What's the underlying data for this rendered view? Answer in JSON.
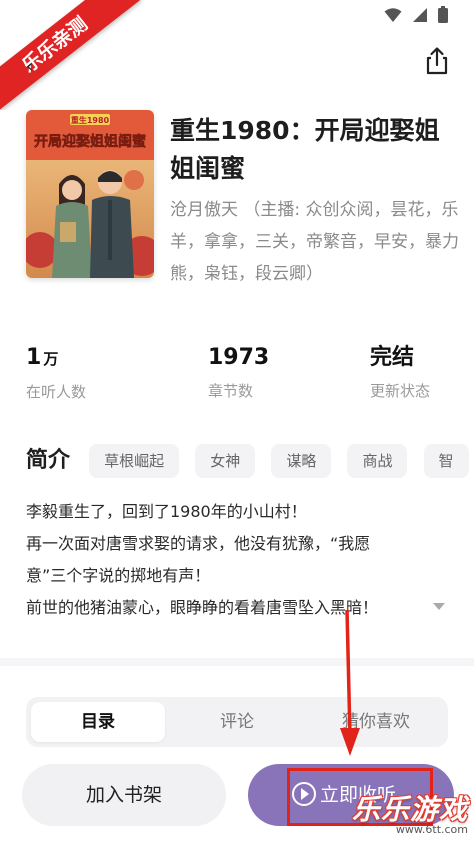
{
  "status_bar": {
    "icons": [
      "wifi-icon",
      "signal-icon",
      "battery-icon"
    ]
  },
  "watermark_ribbon": "乐乐亲测",
  "header": {
    "share_icon": "share-icon"
  },
  "book": {
    "title": "重生1980：开局迎娶姐姐闺蜜",
    "author_line": "沧月傲天 （主播: 众创众阅，昙花，乐羊，拿拿，三关，帝繁音，早安，暴力熊，枭钰，段云卿）",
    "cover": {
      "top_banner": "重生1980",
      "title": "开局迎娶姐姐闺蜜"
    }
  },
  "stats": [
    {
      "value": "1",
      "unit": "万",
      "label": "在听人数"
    },
    {
      "value": "1973",
      "unit": "",
      "label": "章节数"
    },
    {
      "value": "完结",
      "unit": "",
      "label": "更新状态"
    }
  ],
  "intro": {
    "heading": "简介",
    "tags": [
      "草根崛起",
      "女神",
      "谋略",
      "商战",
      "智"
    ],
    "lines": [
      "李毅重生了，回到了1980年的小山村！",
      "再一次面对唐雪求娶的请求，他没有犹豫，“我愿",
      "意”三个字说的掷地有声！",
      "前世的他猪油蒙心，眼睁睁的看着唐雪坠入黑暗！"
    ]
  },
  "tabs": [
    {
      "label": "目录",
      "active": true
    },
    {
      "label": "评论",
      "active": false
    },
    {
      "label": "猜你喜欢",
      "active": false
    }
  ],
  "actions": {
    "add_shelf": "加入书架",
    "listen_now": "立即收听"
  },
  "colors": {
    "primary_purple": "#8a74b9",
    "annotation_red": "#e2231a"
  },
  "watermark": {
    "main": "乐乐游戏",
    "url": "www.6tt.com"
  }
}
